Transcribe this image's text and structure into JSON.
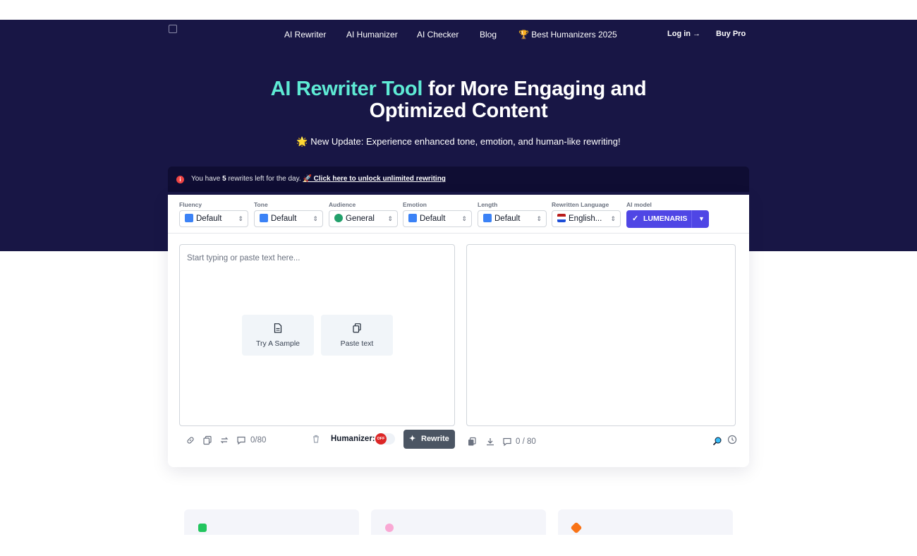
{
  "nav": {
    "items": [
      "AI Rewriter",
      "AI Humanizer",
      "AI Checker",
      "Blog",
      "🏆 Best Humanizers 2025"
    ],
    "login": "Log in →",
    "buy": "Buy Pro"
  },
  "hero": {
    "title_accent": "AI Rewriter Tool",
    "title_rest_line1": " for More Engaging and",
    "title_line2": "Optimized Content",
    "subtitle": "🌟 New Update: Experience enhanced tone, emotion, and human-like rewriting!"
  },
  "notice": {
    "text_before": "You have ",
    "count": "5",
    "text_after": " rewrites left for the day. ",
    "link": "🚀 Click here to unlock unlimited rewriting"
  },
  "options": [
    {
      "label": "Fluency",
      "value": "Default",
      "icon": "refresh-emoji-icon"
    },
    {
      "label": "Tone",
      "value": "Default",
      "icon": "refresh-emoji-icon"
    },
    {
      "label": "Audience",
      "value": "General",
      "icon": "globe-emoji-icon"
    },
    {
      "label": "Emotion",
      "value": "Default",
      "icon": "refresh-emoji-icon"
    },
    {
      "label": "Length",
      "value": "Default",
      "icon": "refresh-emoji-icon"
    },
    {
      "label": "Rewritten Language",
      "value": "English...",
      "icon": "us-flag-icon"
    }
  ],
  "model": {
    "label": "AI model",
    "value": "LUMENARIS"
  },
  "editor": {
    "placeholder": "Start typing or paste text here...",
    "sample_label": "Try A Sample",
    "paste_label": "Paste text",
    "input_count": "0/80",
    "humanizer_label": "Humanizer:",
    "humanizer_state": "OFF",
    "rewrite_label": "Rewrite",
    "output_count": "0 / 80"
  },
  "features": [
    {
      "icon": "check-mark-emoji-icon",
      "color": "#22c55e"
    },
    {
      "icon": "brain-emoji-icon",
      "color": "#f9a8d4"
    },
    {
      "icon": "collision-emoji-icon",
      "color": "#f97316"
    }
  ],
  "colors": {
    "hero_bg": "#181645",
    "accent": "#5eead4",
    "model_btn": "#4f46e5",
    "rewrite_btn": "#4b5563"
  }
}
